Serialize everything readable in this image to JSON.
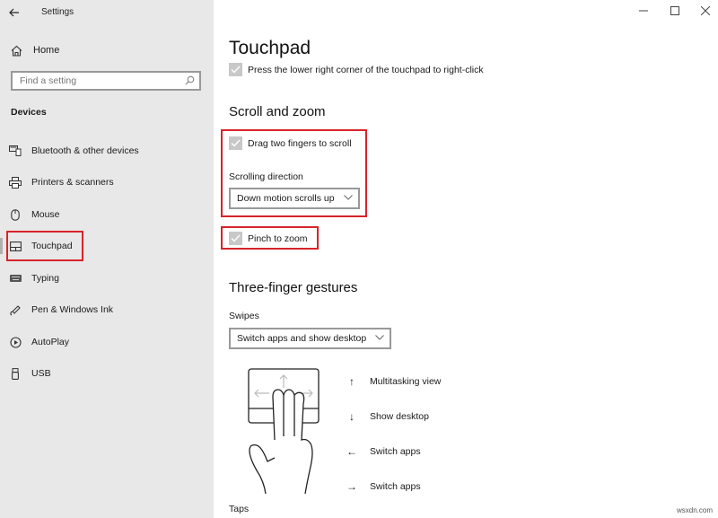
{
  "window": {
    "title": "Settings",
    "controls": {
      "minimize": "minimize",
      "maximize": "maximize",
      "close": "close"
    }
  },
  "sidebar": {
    "home_label": "Home",
    "search_placeholder": "Find a setting",
    "section_label": "Devices",
    "items": [
      {
        "label": "Bluetooth & other devices",
        "icon": "bluetooth-devices-icon",
        "selected": false
      },
      {
        "label": "Printers & scanners",
        "icon": "printer-icon",
        "selected": false
      },
      {
        "label": "Mouse",
        "icon": "mouse-icon",
        "selected": false
      },
      {
        "label": "Touchpad",
        "icon": "touchpad-icon",
        "selected": true
      },
      {
        "label": "Typing",
        "icon": "keyboard-icon",
        "selected": false
      },
      {
        "label": "Pen & Windows Ink",
        "icon": "pen-icon",
        "selected": false
      },
      {
        "label": "AutoPlay",
        "icon": "autoplay-icon",
        "selected": false
      },
      {
        "label": "USB",
        "icon": "usb-icon",
        "selected": false
      }
    ]
  },
  "main": {
    "title": "Touchpad",
    "right_click_option": {
      "label": "Press the lower right corner of the touchpad to right-click",
      "checked": true
    },
    "scroll_zoom": {
      "heading": "Scroll and zoom",
      "drag_two_fingers": {
        "label": "Drag two fingers to scroll",
        "checked": true
      },
      "scrolling_direction_label": "Scrolling direction",
      "scrolling_direction_value": "Down motion scrolls up",
      "pinch_to_zoom": {
        "label": "Pinch to zoom",
        "checked": true
      }
    },
    "three_finger": {
      "heading": "Three-finger gestures",
      "swipes_label": "Swipes",
      "swipes_value": "Switch apps and show desktop",
      "gestures": [
        {
          "arrow": "↑",
          "label": "Multitasking view"
        },
        {
          "arrow": "↓",
          "label": "Show desktop"
        },
        {
          "arrow": "←",
          "label": "Switch apps"
        },
        {
          "arrow": "→",
          "label": "Switch apps"
        }
      ],
      "taps_label": "Taps"
    }
  },
  "highlight_color": "#d8232a",
  "watermark": "wsxdn.com"
}
